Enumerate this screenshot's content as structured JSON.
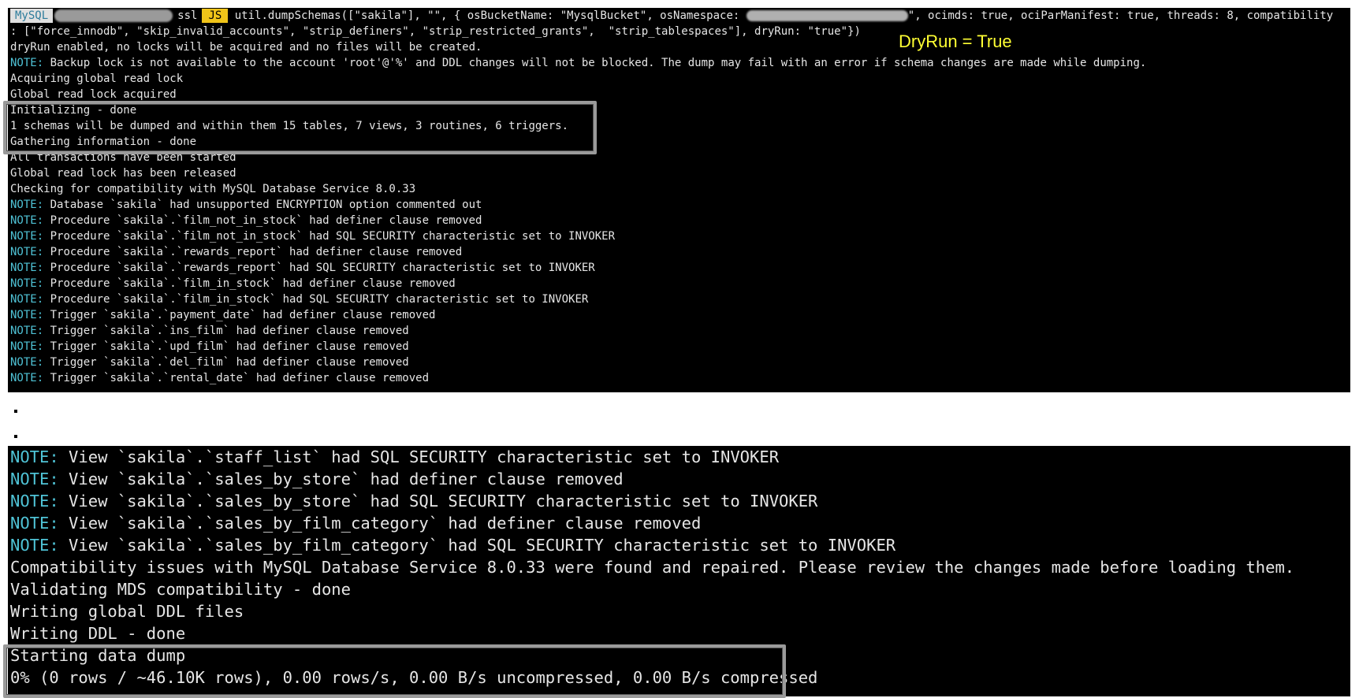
{
  "prompt": {
    "mysql_label": "MySQL",
    "ssl_label": "ssl",
    "js_label": "JS"
  },
  "command": {
    "line1_a": " util.dumpSchemas([\"sakila\"], \"\", { osBucketName: \"MysqlBucket\", osNamespace: ",
    "line1_b": "\", ocimds: true, ociParManifest: true, threads: 8, compatibility",
    "line2": ": [\"force_innodb\", \"skip_invalid_accounts\", \"strip_definers\", \"strip_restricted_grants\",  \"strip_tablespaces\"], dryRun: \"true\"})"
  },
  "annotation": "DryRun = True",
  "output1": [
    {
      "prefix": "",
      "text": "dryRun enabled, no locks will be acquired and no files will be created."
    },
    {
      "prefix": "NOTE:",
      "text": " Backup lock is not available to the account 'root'@'%' and DDL changes will not be blocked. The dump may fail with an error if schema changes are made while dumping."
    },
    {
      "prefix": "",
      "text": "Acquiring global read lock"
    },
    {
      "prefix": "",
      "text": "Global read lock acquired"
    },
    {
      "prefix": "",
      "text": "Initializing - done"
    },
    {
      "prefix": "",
      "text": "1 schemas will be dumped and within them 15 tables, 7 views, 3 routines, 6 triggers."
    },
    {
      "prefix": "",
      "text": "Gathering information - done"
    },
    {
      "prefix": "",
      "text": "All transactions have been started"
    },
    {
      "prefix": "",
      "text": "Global read lock has been released"
    },
    {
      "prefix": "",
      "text": "Checking for compatibility with MySQL Database Service 8.0.33"
    },
    {
      "prefix": "NOTE:",
      "text": " Database `sakila` had unsupported ENCRYPTION option commented out"
    },
    {
      "prefix": "NOTE:",
      "text": " Procedure `sakila`.`film_not_in_stock` had definer clause removed"
    },
    {
      "prefix": "NOTE:",
      "text": " Procedure `sakila`.`film_not_in_stock` had SQL SECURITY characteristic set to INVOKER"
    },
    {
      "prefix": "NOTE:",
      "text": " Procedure `sakila`.`rewards_report` had definer clause removed"
    },
    {
      "prefix": "NOTE:",
      "text": " Procedure `sakila`.`rewards_report` had SQL SECURITY characteristic set to INVOKER"
    },
    {
      "prefix": "NOTE:",
      "text": " Procedure `sakila`.`film_in_stock` had definer clause removed"
    },
    {
      "prefix": "NOTE:",
      "text": " Procedure `sakila`.`film_in_stock` had SQL SECURITY characteristic set to INVOKER"
    },
    {
      "prefix": "NOTE:",
      "text": " Trigger `sakila`.`payment_date` had definer clause removed"
    },
    {
      "prefix": "NOTE:",
      "text": " Trigger `sakila`.`ins_film` had definer clause removed"
    },
    {
      "prefix": "NOTE:",
      "text": " Trigger `sakila`.`upd_film` had definer clause removed"
    },
    {
      "prefix": "NOTE:",
      "text": " Trigger `sakila`.`del_film` had definer clause removed"
    },
    {
      "prefix": "NOTE:",
      "text": " Trigger `sakila`.`rental_date` had definer clause removed"
    }
  ],
  "output2": [
    {
      "prefix": "NOTE:",
      "text": " View `sakila`.`staff_list` had SQL SECURITY characteristic set to INVOKER"
    },
    {
      "prefix": "NOTE:",
      "text": " View `sakila`.`sales_by_store` had definer clause removed"
    },
    {
      "prefix": "NOTE:",
      "text": " View `sakila`.`sales_by_store` had SQL SECURITY characteristic set to INVOKER"
    },
    {
      "prefix": "NOTE:",
      "text": " View `sakila`.`sales_by_film_category` had definer clause removed"
    },
    {
      "prefix": "NOTE:",
      "text": " View `sakila`.`sales_by_film_category` had SQL SECURITY characteristic set to INVOKER"
    },
    {
      "prefix": "",
      "text": "Compatibility issues with MySQL Database Service 8.0.33 were found and repaired. Please review the changes made before loading them."
    },
    {
      "prefix": "",
      "text": "Validating MDS compatibility - done"
    },
    {
      "prefix": "",
      "text": "Writing global DDL files"
    },
    {
      "prefix": "",
      "text": "Writing DDL - done"
    },
    {
      "prefix": "",
      "text": "Starting data dump"
    },
    {
      "prefix": "",
      "text": "0% (0 rows / ~46.10K rows), 0.00 rows/s, 0.00 B/s uncompressed, 0.00 B/s compressed"
    }
  ]
}
